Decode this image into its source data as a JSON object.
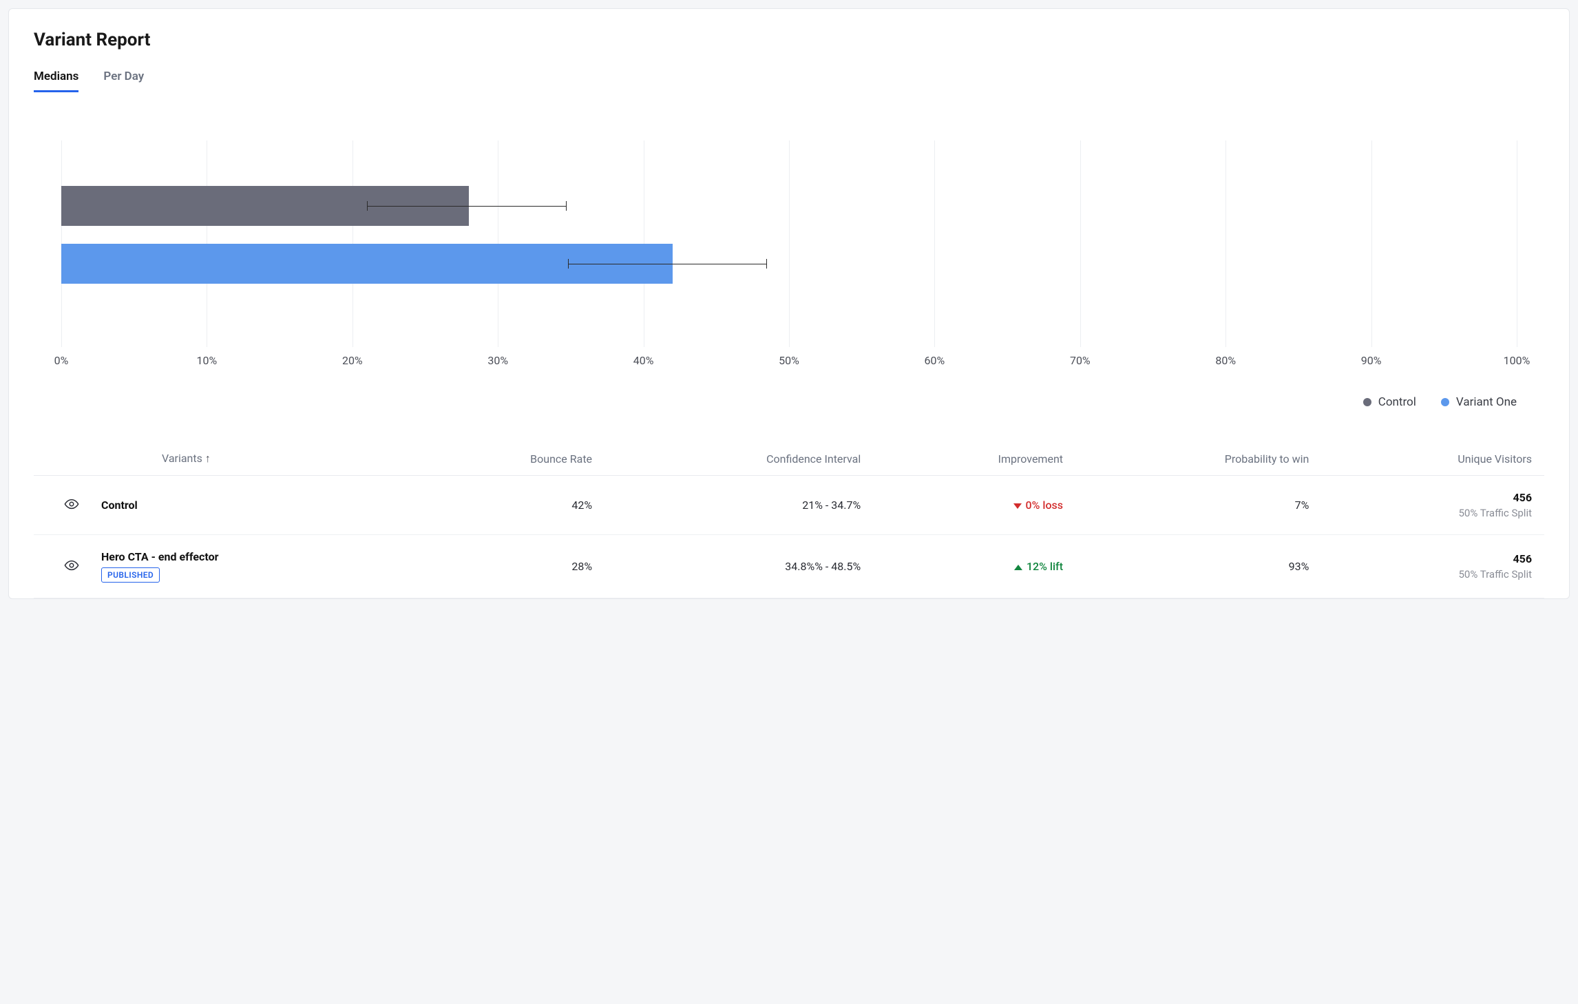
{
  "title": "Variant Report",
  "tabs": {
    "medians": "Medians",
    "per_day": "Per Day",
    "active": "medians"
  },
  "chart_data": {
    "type": "bar",
    "orientation": "horizontal",
    "xlabel": "",
    "ylabel": "",
    "xlim": [
      0,
      100
    ],
    "xticks": [
      "0%",
      "10%",
      "20%",
      "30%",
      "40%",
      "50%",
      "60%",
      "70%",
      "80%",
      "90%",
      "100%"
    ],
    "series": [
      {
        "name": "Control",
        "value": 28,
        "ci": [
          21,
          34.7
        ],
        "color": "#6a6c7a"
      },
      {
        "name": "Variant One",
        "value": 42,
        "ci": [
          34.8,
          48.5
        ],
        "color": "#5c98ec"
      }
    ],
    "legend": [
      "Control",
      "Variant One"
    ]
  },
  "table": {
    "columns": {
      "variants": "Variants",
      "bounce_rate": "Bounce Rate",
      "ci": "Confidence Interval",
      "improvement": "Improvement",
      "prob_win": "Probability to win",
      "unique_visitors": "Unique Visitors"
    },
    "sort_indicator": "↑",
    "rows": [
      {
        "name": "Control",
        "badge": null,
        "bounce_rate": "42%",
        "ci": "21%  - 34.7%",
        "improvement": {
          "direction": "down",
          "text": "0% loss"
        },
        "prob_win": "7%",
        "visitors": {
          "count": "456",
          "split": "50% Traffic Split"
        }
      },
      {
        "name": "Hero CTA - end effector",
        "badge": "PUBLISHED",
        "bounce_rate": "28%",
        "ci": "34.8%%  - 48.5%",
        "improvement": {
          "direction": "up",
          "text": "12% lift"
        },
        "prob_win": "93%",
        "visitors": {
          "count": "456",
          "split": "50% Traffic Split"
        }
      }
    ]
  }
}
